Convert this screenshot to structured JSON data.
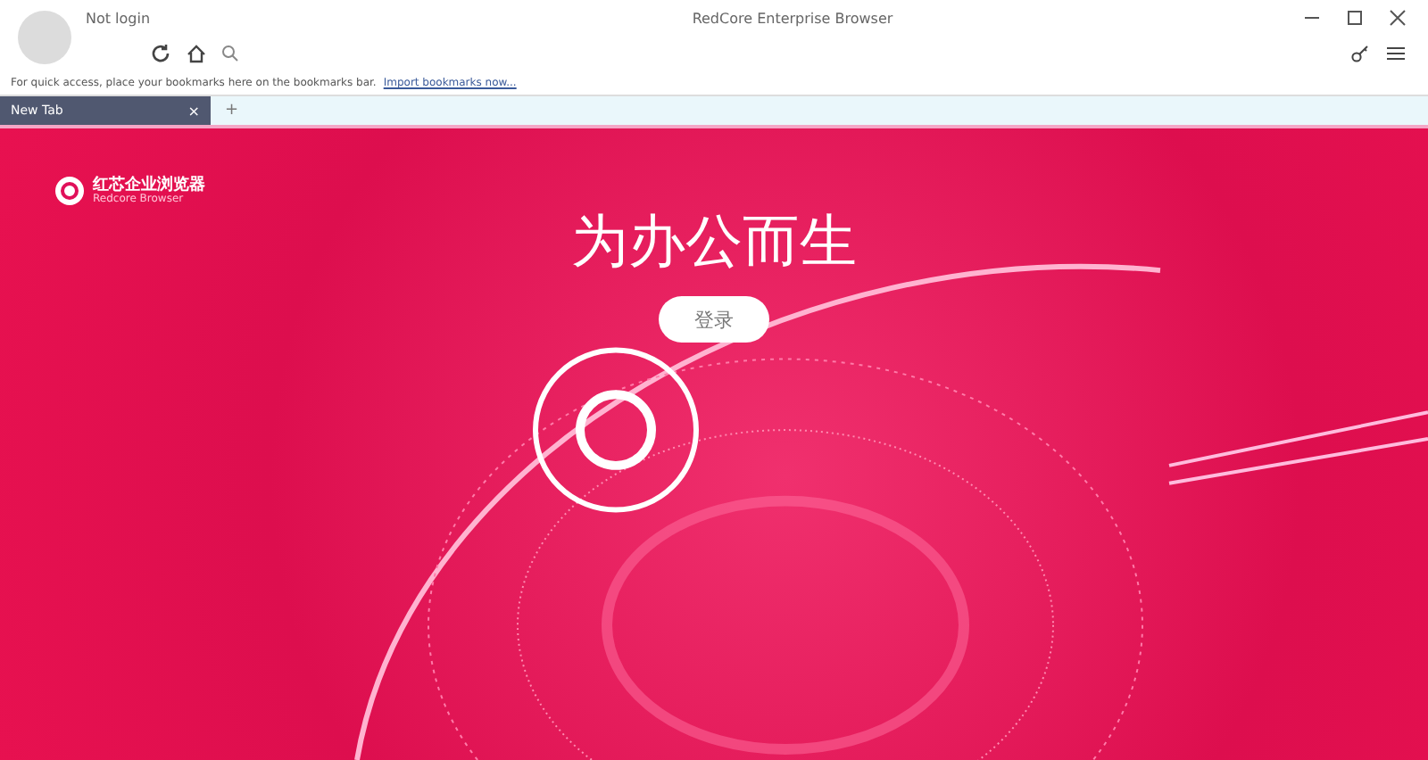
{
  "window": {
    "title": "RedCore Enterprise Browser",
    "user": "Not login"
  },
  "bookmarks_bar": {
    "message": "For quick access, place your bookmarks here on the bookmarks bar.",
    "link": "Import bookmarks now..."
  },
  "tabs": [
    {
      "label": "New Tab",
      "close": "×",
      "selected": true
    }
  ],
  "new_tab": "+",
  "page": {
    "logo_name": "红芯企业浏览器",
    "logo_subtitle": "Redcore Browser",
    "slogan": "为办公而生",
    "login_button": "登录"
  }
}
